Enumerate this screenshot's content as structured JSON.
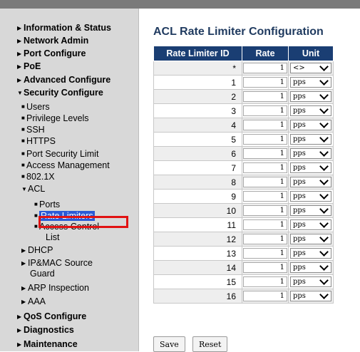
{
  "sidebar": {
    "information_status": "Information & Status",
    "network_admin": "Network Admin",
    "port_configure": "Port Configure",
    "poe": "PoE",
    "advanced_configure": "Advanced Configure",
    "security_configure": "Security Configure",
    "users": "Users",
    "privilege_levels": "Privilege Levels",
    "ssh": "SSH",
    "https": "HTTPS",
    "port_security_limit": "Port Security Limit",
    "access_management": "Access Management",
    "dot1x": "802.1X",
    "acl": "ACL",
    "ports": "Ports",
    "rate_limiters": "Rate Limiters",
    "access_control": "Access Control",
    "list": "List",
    "dhcp": "DHCP",
    "ipmac_source": "IP&MAC Source",
    "guard": "Guard",
    "arp_inspection": "ARP Inspection",
    "aaa": "AAA",
    "qos_configure": "QoS Configure",
    "diagnostics": "Diagnostics",
    "maintenance": "Maintenance"
  },
  "page": {
    "title": "ACL Rate Limiter Configuration"
  },
  "table": {
    "headers": {
      "id": "Rate Limiter ID",
      "rate": "Rate",
      "unit": "Unit"
    },
    "rows": [
      {
        "id": "*",
        "rate": "1",
        "unit": "<>"
      },
      {
        "id": "1",
        "rate": "1",
        "unit": "pps"
      },
      {
        "id": "2",
        "rate": "1",
        "unit": "pps"
      },
      {
        "id": "3",
        "rate": "1",
        "unit": "pps"
      },
      {
        "id": "4",
        "rate": "1",
        "unit": "pps"
      },
      {
        "id": "5",
        "rate": "1",
        "unit": "pps"
      },
      {
        "id": "6",
        "rate": "1",
        "unit": "pps"
      },
      {
        "id": "7",
        "rate": "1",
        "unit": "pps"
      },
      {
        "id": "8",
        "rate": "1",
        "unit": "pps"
      },
      {
        "id": "9",
        "rate": "1",
        "unit": "pps"
      },
      {
        "id": "10",
        "rate": "1",
        "unit": "pps"
      },
      {
        "id": "11",
        "rate": "1",
        "unit": "pps"
      },
      {
        "id": "12",
        "rate": "1",
        "unit": "pps"
      },
      {
        "id": "13",
        "rate": "1",
        "unit": "pps"
      },
      {
        "id": "14",
        "rate": "1",
        "unit": "pps"
      },
      {
        "id": "15",
        "rate": "1",
        "unit": "pps"
      },
      {
        "id": "16",
        "rate": "1",
        "unit": "pps"
      }
    ]
  },
  "buttons": {
    "save": "Save",
    "reset": "Reset"
  },
  "colors": {
    "header_bg": "#1a3e73",
    "selected_bg": "#2a5bd7",
    "highlight_box": "#e11212"
  }
}
